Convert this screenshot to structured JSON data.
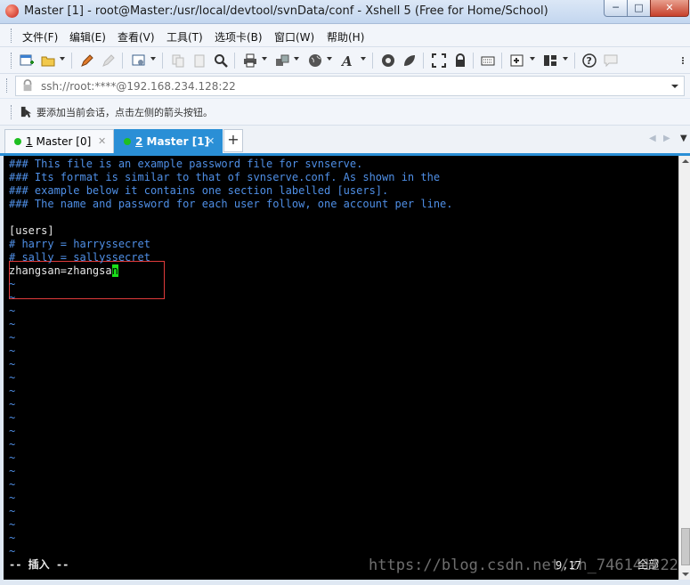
{
  "window": {
    "title": "Master [1] - root@Master:/usr/local/devtool/svnData/conf - Xshell 5 (Free for Home/School)",
    "min_label": "─",
    "max_label": "□",
    "close_label": "✕"
  },
  "menu": [
    "文件(F)",
    "编辑(E)",
    "查看(V)",
    "工具(T)",
    "选项卡(B)",
    "窗口(W)",
    "帮助(H)"
  ],
  "address": {
    "value": "ssh://root:****@192.168.234.128:22"
  },
  "hint": {
    "text": "要添加当前会话，点击左侧的箭头按钮。"
  },
  "tabs": [
    {
      "number": "1",
      "label": "Master [0]",
      "active": false
    },
    {
      "number": "2",
      "label": "Master [1]",
      "active": true
    }
  ],
  "tab_add_label": "+",
  "terminal": {
    "lines": [
      {
        "text": "### This file is an example password file for svnserve.",
        "style": "comment"
      },
      {
        "text": "### Its format is similar to that of svnserve.conf. As shown in the",
        "style": "comment"
      },
      {
        "text": "### example below it contains one section labelled [users].",
        "style": "comment"
      },
      {
        "text": "### The name and password for each user follow, one account per line.",
        "style": "comment"
      },
      {
        "text": "",
        "style": "normal"
      },
      {
        "text": "[users]",
        "style": "normal"
      },
      {
        "text": "# harry = harryssecret",
        "style": "comment"
      },
      {
        "text": "# sally = sallyssecret",
        "style": "comment"
      }
    ],
    "edit_line_text": "zhangsan=zhangsa",
    "cursor_char": "n",
    "tilde_char": "~",
    "tilde_count": 21,
    "status_mode": "-- 插入 --",
    "status_position": "9,17",
    "status_scope": "全部",
    "watermark": "https://blog.csdn.net/zh_7461412229"
  },
  "colors": {
    "accent": "#2a8fd6",
    "comment": "#4f8fe6",
    "cursor": "#19e019",
    "highlight": "#e03b3b"
  },
  "icons": [
    "new-session-icon",
    "open-folder-icon",
    "pencil-icon",
    "pen-disabled-icon",
    "properties-icon",
    "copy-icon",
    "paste-icon",
    "find-icon",
    "print-icon",
    "transfer-icon",
    "globe-icon",
    "font-icon",
    "xftp-icon",
    "xmanager-icon",
    "fullscreen-icon",
    "lock-icon",
    "keyboard-icon",
    "new-tab-icon",
    "layout-icon",
    "help-icon",
    "chat-icon"
  ]
}
